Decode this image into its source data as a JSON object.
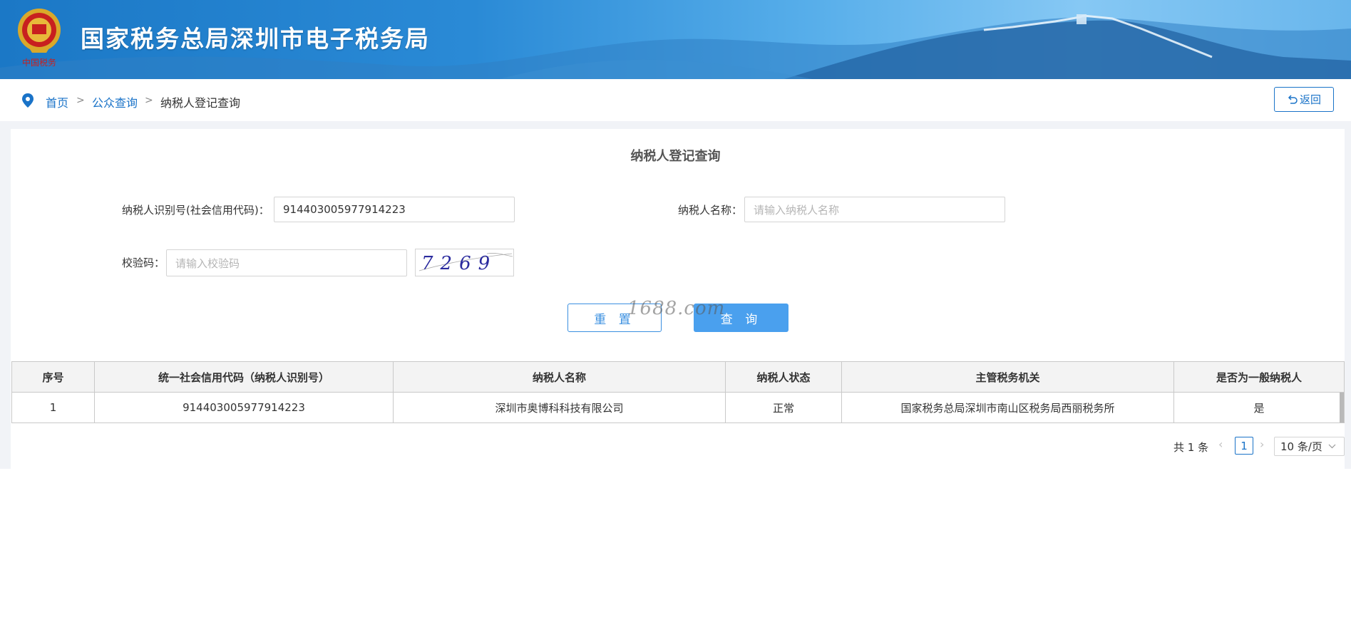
{
  "header": {
    "site_title": "国家税务总局深圳市电子税务局",
    "logo_icon": "tax-emblem-icon",
    "logo_text": "中国税务"
  },
  "breadcrumb": {
    "items": [
      "首页",
      "公众查询",
      "纳税人登记查询"
    ],
    "separator": ">"
  },
  "back_button": {
    "label": "返回",
    "icon": "undo-icon"
  },
  "form": {
    "title": "纳税人登记查询",
    "taxpayer_id_label": "纳税人识别号(社会信用代码)：",
    "taxpayer_id_value": "914403005977914223",
    "taxpayer_name_label": "纳税人名称：",
    "taxpayer_name_placeholder": "请输入纳税人名称",
    "captcha_label": "校验码：",
    "captcha_placeholder": "请输入校验码",
    "captcha_image_text": "7269",
    "reset_label": "重 置",
    "query_label": "查 询"
  },
  "watermark": "1688.com",
  "table": {
    "columns": [
      "序号",
      "统一社会信用代码（纳税人识别号）",
      "纳税人名称",
      "纳税人状态",
      "主管税务机关",
      "是否为一般纳税人"
    ],
    "rows": [
      [
        "1",
        "914403005977914223",
        "深圳市奥博科科技有限公司",
        "正常",
        "国家税务总局深圳市南山区税务局西丽税务所",
        "是"
      ]
    ]
  },
  "pagination": {
    "total_text": "共 1 条",
    "current_page": "1",
    "page_size_text": "10 条/页",
    "prev_icon": "chevron-left-icon",
    "next_icon": "chevron-right-icon"
  },
  "colors": {
    "brand_blue": "#1a73c8",
    "button_blue": "#4aa0ee",
    "banner_blue": "#2a8ad6"
  }
}
